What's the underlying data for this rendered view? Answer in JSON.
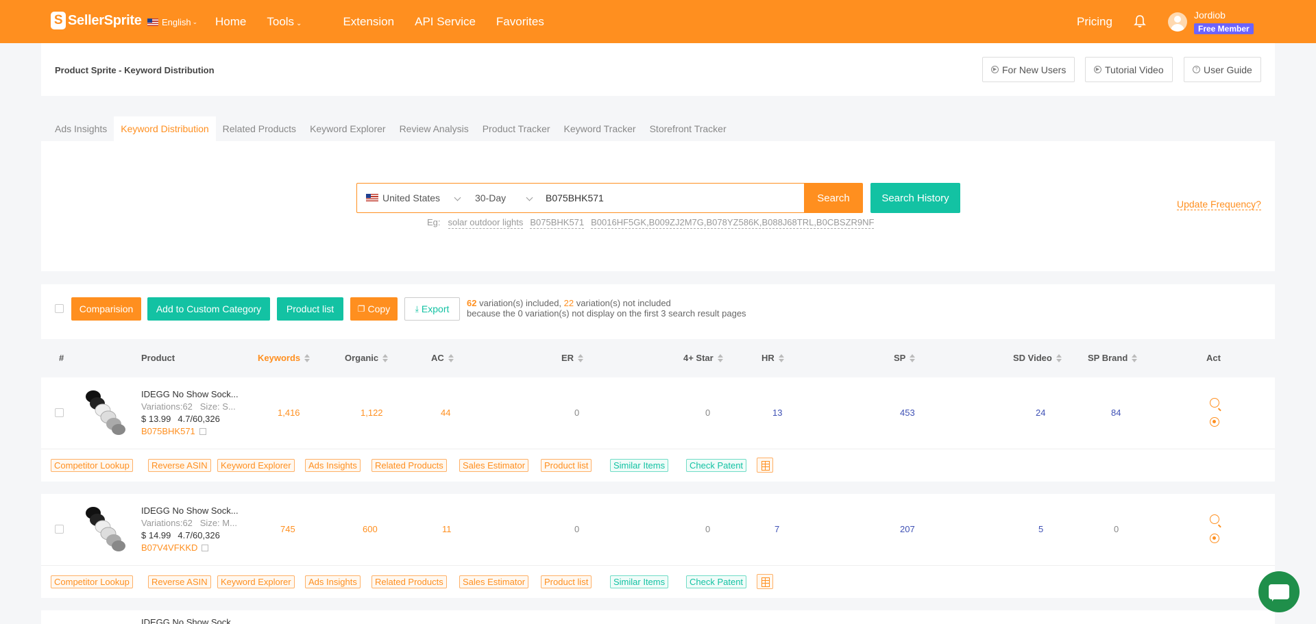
{
  "header": {
    "logo": "SellerSprite",
    "logo_mark": "S",
    "language": "English",
    "nav": [
      "Home",
      "Tools",
      "Extension",
      "API Service",
      "Favorites"
    ],
    "pricing": "Pricing",
    "username": "Jordiob",
    "member_badge": "Free Member",
    "brand_color": "#ff8f1f"
  },
  "page": {
    "title": "Product Sprite - Keyword Distribution",
    "help_buttons": [
      "For New Users",
      "Tutorial Video",
      "User Guide"
    ]
  },
  "tabs": [
    "Ads Insights",
    "Keyword Distribution",
    "Related Products",
    "Keyword Explorer",
    "Review Analysis",
    "Product Tracker",
    "Keyword Tracker",
    "Storefront Tracker"
  ],
  "active_tab": "Keyword Distribution",
  "search": {
    "country": "United States",
    "period": "30-Day",
    "asin": "B075BHK571",
    "search_label": "Search",
    "history_label": "Search History",
    "eg_label": "Eg:",
    "examples": [
      "solar outdoor lights",
      "B075BHK571",
      "B0016HF5GK,B009ZJ2M7G,B078YZ586K,B088J68TRL,B0CBSZR9NF"
    ],
    "update_frequency": "Update Frequency?"
  },
  "toolbar": {
    "comparision": "Comparision",
    "add_custom_category": "Add to Custom Category",
    "product_list": "Product list",
    "copy": "Copy",
    "export": "Export",
    "included_count": "62",
    "included_text": "variation(s) included,",
    "not_included_count": "22",
    "not_included_text": "variation(s) not included",
    "note": "because the 0 variation(s) not display on the first 3 search result pages"
  },
  "columns": [
    "#",
    "Product",
    "Keywords",
    "Organic",
    "AC",
    "ER",
    "4+ Star",
    "HR",
    "SP",
    "SD Video",
    "SP Brand",
    "Act"
  ],
  "rows": [
    {
      "name": "IDEGG No Show Sock...",
      "variations": "Variations:62",
      "size": "Size: S...",
      "price": "$ 13.99",
      "rating": "4.7/60,326",
      "asin": "B075BHK571",
      "keywords": "1,416",
      "organic": "1,122",
      "ac": "44",
      "er": "0",
      "star4": "0",
      "hr": "13",
      "sp": "453",
      "sd_video": "24",
      "sp_brand": "84"
    },
    {
      "name": "IDEGG No Show Sock...",
      "variations": "Variations:62",
      "size": "Size: M...",
      "price": "$ 14.99",
      "rating": "4.7/60,326",
      "asin": "B07V4VFKKD",
      "keywords": "745",
      "organic": "600",
      "ac": "11",
      "er": "0",
      "star4": "0",
      "hr": "7",
      "sp": "207",
      "sd_video": "5",
      "sp_brand": "0"
    }
  ],
  "row_links": [
    "Competitor Lookup",
    "Reverse ASIN",
    "Keyword Explorer",
    "Ads Insights",
    "Related Products",
    "Sales Estimator",
    "Product list",
    "Similar Items",
    "Check Patent"
  ],
  "partial_row": {
    "name": "IDEGG No Show Sock..."
  }
}
